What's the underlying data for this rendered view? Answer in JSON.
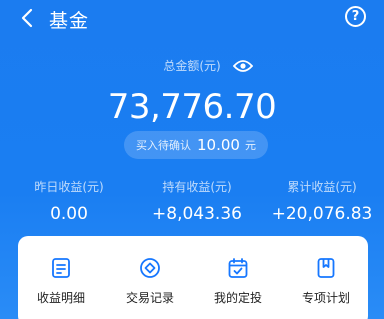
{
  "header": {
    "title": "基金",
    "help_glyph": "?"
  },
  "summary": {
    "total_label": "总金额(元)",
    "total_amount": "73,776.70",
    "pending_label": "买入待确认",
    "pending_amount": "10.00",
    "pending_unit": "元"
  },
  "stats": [
    {
      "label": "昨日收益(元)",
      "value": "0.00"
    },
    {
      "label": "持有收益(元)",
      "value": "+8,043.36"
    },
    {
      "label": "累计收益(元)",
      "value": "+20,076.83"
    }
  ],
  "actions": [
    {
      "label": "收益明细",
      "icon": "document-icon"
    },
    {
      "label": "交易记录",
      "icon": "diamond-circle-icon"
    },
    {
      "label": "我的定投",
      "icon": "calendar-check-icon"
    },
    {
      "label": "专项计划",
      "icon": "bookmark-icon"
    }
  ],
  "colors": {
    "primary_blue": "#1a7ef2",
    "icon_blue": "#1677ff"
  }
}
